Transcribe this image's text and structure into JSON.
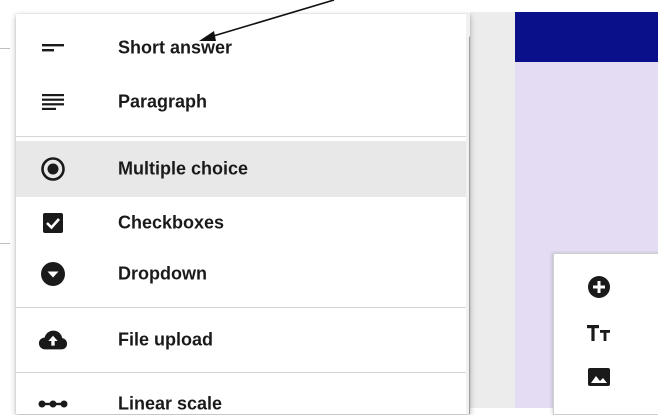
{
  "menu": {
    "items": [
      {
        "label": "Short answer",
        "icon": "short-answer-icon"
      },
      {
        "label": "Paragraph",
        "icon": "paragraph-icon"
      },
      {
        "label": "Multiple choice",
        "icon": "radio-button-icon",
        "selected": true
      },
      {
        "label": "Checkboxes",
        "icon": "checkbox-icon"
      },
      {
        "label": "Dropdown",
        "icon": "dropdown-icon"
      },
      {
        "label": "File upload",
        "icon": "cloud-upload-icon"
      },
      {
        "label": "Linear scale",
        "icon": "linear-scale-icon"
      }
    ]
  },
  "side_toolbar": {
    "tools": [
      "add-question-icon",
      "add-title-icon",
      "add-image-icon"
    ]
  },
  "colors": {
    "header": "#0a0f8a",
    "canvas": "#e3dcf2",
    "selected_row": "#e8e8e8",
    "icon": "#1a1a1a"
  }
}
